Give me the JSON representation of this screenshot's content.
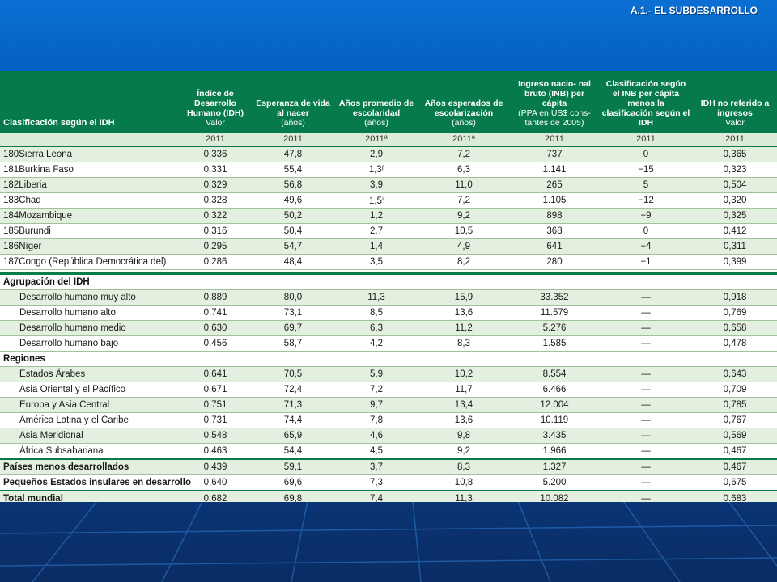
{
  "slide_title": "A.1.- EL SUBDESARROLLO",
  "headers": {
    "col1": "Clasificación según el IDH",
    "col2": "Índice de Desarrollo Humano (IDH)",
    "col2_unit": "Valor",
    "col3": "Esperanza de vida al nacer",
    "col3_unit": "(años)",
    "col4": "Años promedio de escolaridad",
    "col4_unit": "(años)",
    "col5": "Años esperados de escolarización",
    "col5_unit": "(años)",
    "col6": "Ingreso nacio- nal bruto (INB) per cápita",
    "col6_unit": "(PPA en US$ cons- tantes de 2005)",
    "col7": "Clasificación según el INB per cápita menos la clasificación según el IDH",
    "col8": "IDH no referido a ingresos",
    "col8_unit": "Valor"
  },
  "years": [
    "2011",
    "2011",
    "2011ª",
    "2011ª",
    "2011",
    "2011",
    "2011"
  ],
  "countries": [
    {
      "rank": "180",
      "name": "Sierra Leona",
      "idh": "0,336",
      "life": "47,8",
      "avg_school": "2,9",
      "exp_school": "7,2",
      "inb": "737",
      "diff": "0",
      "nonincome": "0,365"
    },
    {
      "rank": "181",
      "name": "Burkina Faso",
      "idh": "0,331",
      "life": "55,4",
      "avg_school": "1,3ᶠ",
      "exp_school": "6,3",
      "inb": "1.141",
      "diff": "−15",
      "nonincome": "0,323"
    },
    {
      "rank": "182",
      "name": "Liberia",
      "idh": "0,329",
      "life": "56,8",
      "avg_school": "3,9",
      "exp_school": "11,0",
      "inb": "265",
      "diff": "5",
      "nonincome": "0,504"
    },
    {
      "rank": "183",
      "name": "Chad",
      "idh": "0,328",
      "life": "49,6",
      "avg_school": "1,5ⁱ",
      "exp_school": "7,2",
      "inb": "1.105",
      "diff": "−12",
      "nonincome": "0,320"
    },
    {
      "rank": "184",
      "name": "Mozambique",
      "idh": "0,322",
      "life": "50,2",
      "avg_school": "1,2",
      "exp_school": "9,2",
      "inb": "898",
      "diff": "−9",
      "nonincome": "0,325"
    },
    {
      "rank": "185",
      "name": "Burundi",
      "idh": "0,316",
      "life": "50,4",
      "avg_school": "2,7",
      "exp_school": "10,5",
      "inb": "368",
      "diff": "0",
      "nonincome": "0,412"
    },
    {
      "rank": "186",
      "name": "Níger",
      "idh": "0,295",
      "life": "54,7",
      "avg_school": "1,4",
      "exp_school": "4,9",
      "inb": "641",
      "diff": "−4",
      "nonincome": "0,311"
    },
    {
      "rank": "187",
      "name": "Congo (República Democrática del)",
      "idh": "0,286",
      "life": "48,4",
      "avg_school": "3,5",
      "exp_school": "8,2",
      "inb": "280",
      "diff": "−1",
      "nonincome": "0,399"
    }
  ],
  "section_idh": "Agrupación del IDH",
  "groups": [
    {
      "name": "Desarrollo humano muy alto",
      "idh": "0,889",
      "life": "80,0",
      "avg_school": "11,3",
      "exp_school": "15,9",
      "inb": "33.352",
      "diff": "—",
      "nonincome": "0,918"
    },
    {
      "name": "Desarrollo humano alto",
      "idh": "0,741",
      "life": "73,1",
      "avg_school": "8,5",
      "exp_school": "13,6",
      "inb": "11.579",
      "diff": "—",
      "nonincome": "0,769"
    },
    {
      "name": "Desarrollo humano medio",
      "idh": "0,630",
      "life": "69,7",
      "avg_school": "6,3",
      "exp_school": "11,2",
      "inb": "5.276",
      "diff": "—",
      "nonincome": "0,658"
    },
    {
      "name": "Desarrollo humano bajo",
      "idh": "0,456",
      "life": "58,7",
      "avg_school": "4,2",
      "exp_school": "8,3",
      "inb": "1.585",
      "diff": "—",
      "nonincome": "0,478"
    }
  ],
  "section_regions": "Regiones",
  "regions": [
    {
      "name": "Estados Árabes",
      "idh": "0,641",
      "life": "70,5",
      "avg_school": "5,9",
      "exp_school": "10,2",
      "inb": "8.554",
      "diff": "—",
      "nonincome": "0,643"
    },
    {
      "name": "Asia Oriental y el Pacífico",
      "idh": "0,671",
      "life": "72,4",
      "avg_school": "7,2",
      "exp_school": "11,7",
      "inb": "6.466",
      "diff": "—",
      "nonincome": "0,709"
    },
    {
      "name": "Europa y Asia Central",
      "idh": "0,751",
      "life": "71,3",
      "avg_school": "9,7",
      "exp_school": "13,4",
      "inb": "12.004",
      "diff": "—",
      "nonincome": "0,785"
    },
    {
      "name": "América Latina y el Caribe",
      "idh": "0,731",
      "life": "74,4",
      "avg_school": "7,8",
      "exp_school": "13,6",
      "inb": "10.119",
      "diff": "—",
      "nonincome": "0,767"
    },
    {
      "name": "Asia Meridional",
      "idh": "0,548",
      "life": "65,9",
      "avg_school": "4,6",
      "exp_school": "9,8",
      "inb": "3.435",
      "diff": "—",
      "nonincome": "0,569"
    },
    {
      "name": "África Subsahariana",
      "idh": "0,463",
      "life": "54,4",
      "avg_school": "4,5",
      "exp_school": "9,2",
      "inb": "1.966",
      "diff": "—",
      "nonincome": "0,467"
    }
  ],
  "summary": [
    {
      "name": "Países menos desarrollados",
      "idh": "0,439",
      "life": "59,1",
      "avg_school": "3,7",
      "exp_school": "8,3",
      "inb": "1.327",
      "diff": "—",
      "nonincome": "0,467"
    },
    {
      "name": "Pequeños Estados insulares en desarrollo",
      "idh": "0,640",
      "life": "69,6",
      "avg_school": "7,3",
      "exp_school": "10,8",
      "inb": "5.200",
      "diff": "—",
      "nonincome": "0,675"
    },
    {
      "name": "Total mundial",
      "idh": "0,682",
      "life": "69,8",
      "avg_school": "7,4",
      "exp_school": "11,3",
      "inb": "10.082",
      "diff": "—",
      "nonincome": "0.683"
    }
  ]
}
